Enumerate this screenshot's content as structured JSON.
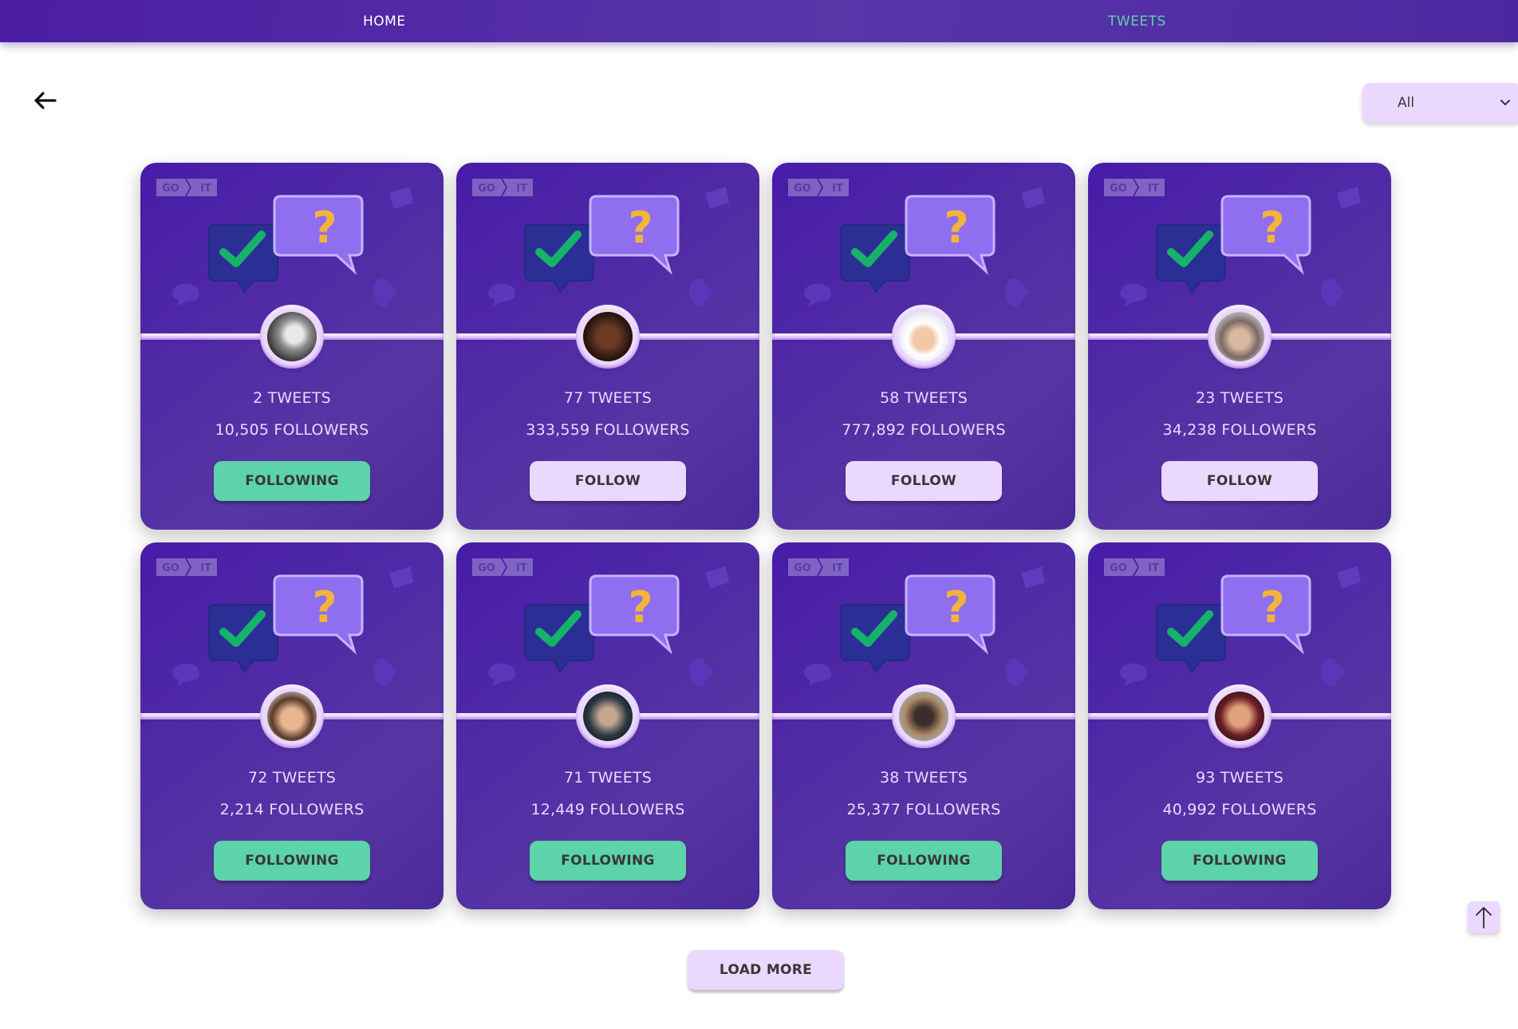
{
  "nav": {
    "home_label": "HOME",
    "tweets_label": "TWEETS"
  },
  "filter": {
    "selected": "All"
  },
  "colors": {
    "header": "#4c1da3",
    "card_bg": "#5736a3",
    "accent_lavender": "#ebd8ff",
    "following_green": "#5cd3a8",
    "active_nav": "#5cd3a8"
  },
  "icons": {
    "back": "arrow-left-icon",
    "filter": "chevron-down-icon",
    "scroll_top": "arrow-up-icon",
    "card_logo": "goit-logo",
    "card_art": "chat-bubbles-illustration"
  },
  "cards": [
    {
      "tweets": "2 TWEETS",
      "followers": "10,505 FOLLOWERS",
      "button": "FOLLOWING",
      "state": "following"
    },
    {
      "tweets": "77 TWEETS",
      "followers": "333,559 FOLLOWERS",
      "button": "FOLLOW",
      "state": "follow"
    },
    {
      "tweets": "58 TWEETS",
      "followers": "777,892 FOLLOWERS",
      "button": "FOLLOW",
      "state": "follow"
    },
    {
      "tweets": "23 TWEETS",
      "followers": "34,238 FOLLOWERS",
      "button": "FOLLOW",
      "state": "follow"
    },
    {
      "tweets": "72 TWEETS",
      "followers": "2,214 FOLLOWERS",
      "button": "FOLLOWING",
      "state": "following"
    },
    {
      "tweets": "71 TWEETS",
      "followers": "12,449 FOLLOWERS",
      "button": "FOLLOWING",
      "state": "following"
    },
    {
      "tweets": "38 TWEETS",
      "followers": "25,377 FOLLOWERS",
      "button": "FOLLOWING",
      "state": "following"
    },
    {
      "tweets": "93 TWEETS",
      "followers": "40,992 FOLLOWERS",
      "button": "FOLLOWING",
      "state": "following"
    }
  ],
  "load_more_label": "LOAD MORE"
}
